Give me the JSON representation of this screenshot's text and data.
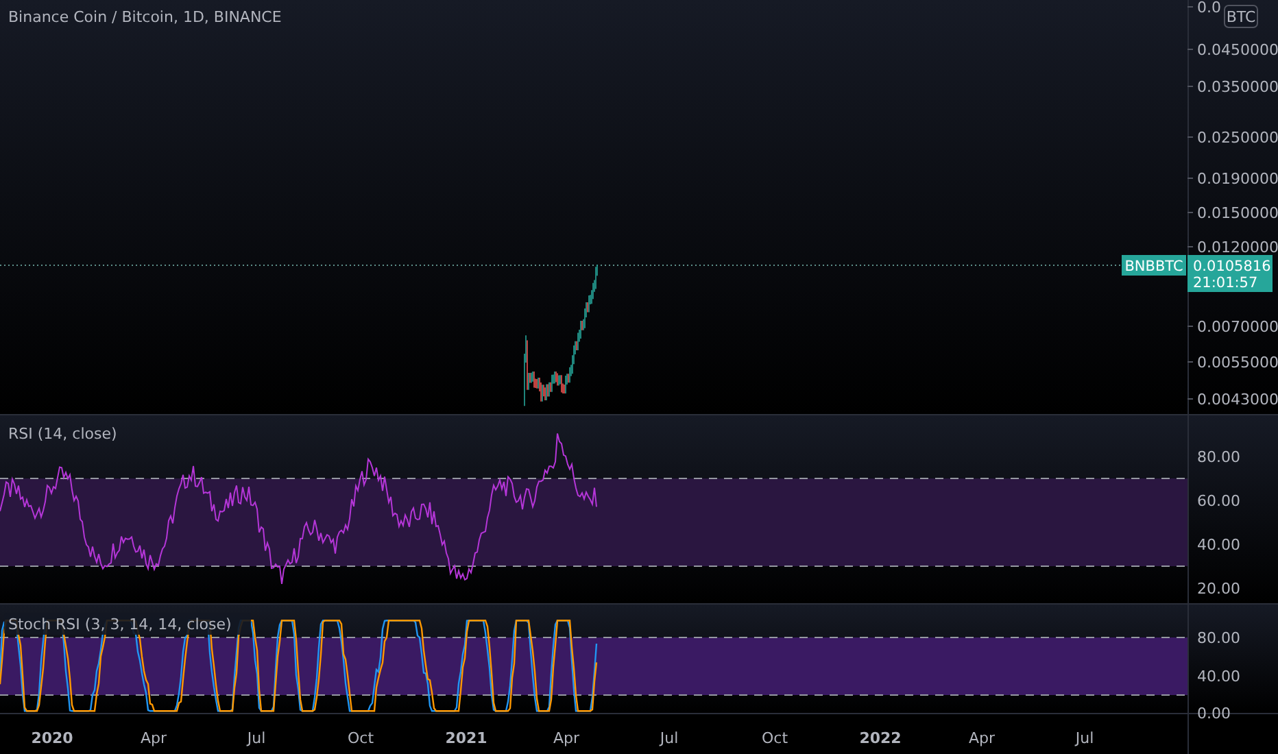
{
  "title": "Binance Coin / Bitcoin, 1D, BINANCE",
  "currency_badge": "BTC",
  "price_axis": [
    "0.0",
    "0.0450000",
    "0.0350000",
    "0.0250000",
    "0.0190000",
    "0.0150000",
    "0.0120000",
    "0.0070000",
    "0.0055000",
    "0.0043000"
  ],
  "symbol_label": "BNBBTC",
  "last_price": "0.0105816",
  "countdown": "21:01:57",
  "panes": [
    {
      "title": "RSI (14, close)",
      "axis": [
        "80.00",
        "60.00",
        "40.00",
        "20.00"
      ]
    },
    {
      "title": "Stoch RSI (3, 3, 14, 14, close)",
      "axis": [
        "80.00",
        "40.00",
        "0.00"
      ]
    }
  ],
  "time_axis": [
    {
      "label": "2020",
      "kind": "year"
    },
    {
      "label": "Apr",
      "kind": "month"
    },
    {
      "label": "Jul",
      "kind": "month"
    },
    {
      "label": "Oct",
      "kind": "month"
    },
    {
      "label": "2021",
      "kind": "year"
    },
    {
      "label": "Apr",
      "kind": "month"
    },
    {
      "label": "Jul",
      "kind": "month"
    },
    {
      "label": "Oct",
      "kind": "month"
    },
    {
      "label": "2022",
      "kind": "year"
    },
    {
      "label": "Apr",
      "kind": "month"
    },
    {
      "label": "Jul",
      "kind": "month"
    }
  ]
}
